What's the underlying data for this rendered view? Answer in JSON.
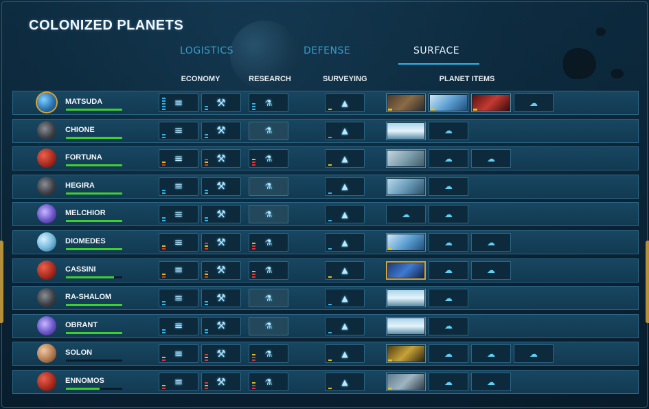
{
  "title": "COLONIZED PLANETS",
  "tabs": [
    {
      "label": "LOGISTICS",
      "active": false
    },
    {
      "label": "DEFENSE",
      "active": false
    },
    {
      "label": "SURFACE",
      "active": true
    }
  ],
  "columns": {
    "economy": "ECONOMY",
    "research": "RESEARCH",
    "surveying": "SURVEYING",
    "planet_items": "PLANET ITEMS"
  },
  "icons": {
    "economy": "layers-icon",
    "industry": "tools-icon",
    "research": "flask-icon",
    "surveying": "survey-ship-icon",
    "empty_slot": "cloud-icon"
  },
  "colors": {
    "bar_green": "#3fd12b",
    "accent_cyan": "#2fb6ee",
    "selected_gold": "#d7a33b",
    "level_blue": "#2fb6ee",
    "level_red": "#d6373a",
    "level_yellow": "#e2c022"
  },
  "planets": [
    {
      "name": "MATSUDA",
      "type": "terran-gold",
      "approval": 1.0,
      "research_dim": false,
      "items": [
        "pic-city",
        "pic-lab",
        "pic-soldiers",
        "empty"
      ],
      "selected": false
    },
    {
      "name": "CHIONE",
      "type": "asteroid",
      "approval": 1.0,
      "research_dim": true,
      "items": [
        "pic-dome",
        "empty"
      ],
      "selected": false
    },
    {
      "name": "FORTUNA",
      "type": "red",
      "approval": 1.0,
      "research_dim": false,
      "items": [
        "pic-ruins",
        "empty",
        "empty"
      ],
      "selected": false
    },
    {
      "name": "HEGIRA",
      "type": "asteroid",
      "approval": 1.0,
      "research_dim": true,
      "items": [
        "pic-city2",
        "empty"
      ],
      "selected": false
    },
    {
      "name": "MELCHIOR",
      "type": "crystal",
      "approval": 1.0,
      "research_dim": true,
      "items": [
        "empty",
        "empty"
      ],
      "selected": false
    },
    {
      "name": "DIOMEDES",
      "type": "ice",
      "approval": 1.0,
      "research_dim": false,
      "items": [
        "pic-lab",
        "empty",
        "empty"
      ],
      "selected": false
    },
    {
      "name": "CASSINI",
      "type": "red",
      "approval": 0.85,
      "research_dim": false,
      "items": [
        "pic-tech",
        "empty",
        "empty"
      ],
      "selected": true
    },
    {
      "name": "RA-SHALOM",
      "type": "asteroid",
      "approval": 1.0,
      "research_dim": true,
      "items": [
        "pic-dome",
        "empty"
      ],
      "selected": false
    },
    {
      "name": "OBRANT",
      "type": "crystal",
      "approval": 1.0,
      "research_dim": true,
      "items": [
        "pic-dome",
        "empty"
      ],
      "selected": false
    },
    {
      "name": "SOLON",
      "type": "barren",
      "approval": 0.0,
      "research_dim": false,
      "items": [
        "pic-soldiers-gold",
        "empty",
        "empty",
        "empty"
      ],
      "selected": false
    },
    {
      "name": "ENNOMOS",
      "type": "red",
      "approval": 0.6,
      "research_dim": false,
      "items": [
        "pic-mechs",
        "empty",
        "empty"
      ],
      "selected": false
    }
  ]
}
